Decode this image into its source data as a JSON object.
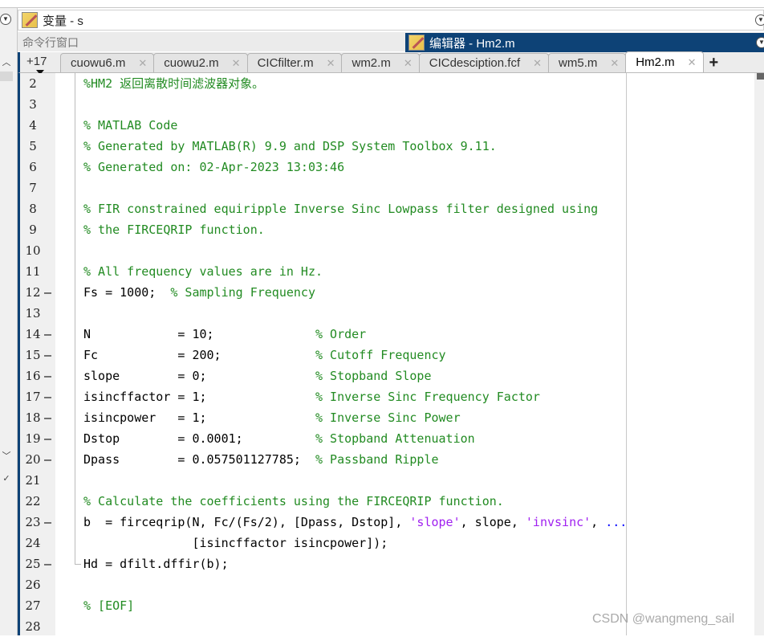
{
  "variables_panel": {
    "title": "变量 - s"
  },
  "command_window": {
    "title": "命令行窗口"
  },
  "editor": {
    "title": "编辑器 - Hm2.m"
  },
  "tabs": {
    "more_label": "+17",
    "items": [
      {
        "label": "cuowu6.m"
      },
      {
        "label": "cuowu2.m"
      },
      {
        "label": "CICfilter.m"
      },
      {
        "label": "wm2.m"
      },
      {
        "label": "CICdesciption.fcf"
      },
      {
        "label": "wm5.m"
      },
      {
        "label": "Hm2.m",
        "active": true
      }
    ],
    "close_glyph": "✕",
    "add_glyph": "+"
  },
  "code_lines": [
    {
      "n": "2",
      "dash": "",
      "segs": [
        [
          "c-com",
          "%HM2 返回离散时间滤波器对象。"
        ]
      ]
    },
    {
      "n": "3",
      "dash": "",
      "segs": []
    },
    {
      "n": "4",
      "dash": "",
      "segs": [
        [
          "c-com",
          "% MATLAB Code"
        ]
      ]
    },
    {
      "n": "5",
      "dash": "",
      "segs": [
        [
          "c-com",
          "% Generated by MATLAB(R) 9.9 and DSP System Toolbox 9.11."
        ]
      ]
    },
    {
      "n": "6",
      "dash": "",
      "segs": [
        [
          "c-com",
          "% Generated on: 02-Apr-2023 13:03:46"
        ]
      ]
    },
    {
      "n": "7",
      "dash": "",
      "segs": []
    },
    {
      "n": "8",
      "dash": "",
      "segs": [
        [
          "c-com",
          "% FIR constrained equiripple Inverse Sinc Lowpass filter designed using"
        ]
      ]
    },
    {
      "n": "9",
      "dash": "",
      "segs": [
        [
          "c-com",
          "% the FIRCEQRIP function."
        ]
      ]
    },
    {
      "n": "10",
      "dash": "",
      "segs": []
    },
    {
      "n": "11",
      "dash": "",
      "segs": [
        [
          "c-com",
          "% All frequency values are in Hz."
        ]
      ]
    },
    {
      "n": "12",
      "dash": "—",
      "segs": [
        [
          "c-txt",
          "Fs = 1000;  "
        ],
        [
          "c-com",
          "% Sampling Frequency"
        ]
      ]
    },
    {
      "n": "13",
      "dash": "",
      "segs": []
    },
    {
      "n": "14",
      "dash": "—",
      "segs": [
        [
          "c-txt",
          "N            = 10;              "
        ],
        [
          "c-com",
          "% Order"
        ]
      ]
    },
    {
      "n": "15",
      "dash": "—",
      "segs": [
        [
          "c-txt",
          "Fc           = 200;             "
        ],
        [
          "c-com",
          "% Cutoff Frequency"
        ]
      ]
    },
    {
      "n": "16",
      "dash": "—",
      "segs": [
        [
          "c-txt",
          "slope        = 0;               "
        ],
        [
          "c-com",
          "% Stopband Slope"
        ]
      ]
    },
    {
      "n": "17",
      "dash": "—",
      "segs": [
        [
          "c-txt",
          "isincffactor = 1;               "
        ],
        [
          "c-com",
          "% Inverse Sinc Frequency Factor"
        ]
      ]
    },
    {
      "n": "18",
      "dash": "—",
      "segs": [
        [
          "c-txt",
          "isincpower   = 1;               "
        ],
        [
          "c-com",
          "% Inverse Sinc Power"
        ]
      ]
    },
    {
      "n": "19",
      "dash": "—",
      "segs": [
        [
          "c-txt",
          "Dstop        = 0.0001;          "
        ],
        [
          "c-com",
          "% Stopband Attenuation"
        ]
      ]
    },
    {
      "n": "20",
      "dash": "—",
      "segs": [
        [
          "c-txt",
          "Dpass        = 0.057501127785;  "
        ],
        [
          "c-com",
          "% Passband Ripple"
        ]
      ]
    },
    {
      "n": "21",
      "dash": "",
      "segs": []
    },
    {
      "n": "22",
      "dash": "",
      "segs": [
        [
          "c-com",
          "% Calculate the coefficients using the FIRCEQRIP function."
        ]
      ]
    },
    {
      "n": "23",
      "dash": "—",
      "segs": [
        [
          "c-txt",
          "b  = firceqrip(N, Fc/(Fs/2), [Dpass, Dstop], "
        ],
        [
          "c-str",
          "'slope'"
        ],
        [
          "c-txt",
          ", slope, "
        ],
        [
          "c-str",
          "'invsinc'"
        ],
        [
          "c-txt",
          ", "
        ],
        [
          "c-kw",
          "..."
        ]
      ]
    },
    {
      "n": "24",
      "dash": "",
      "segs": [
        [
          "c-txt",
          "               [isincffactor isincpower]);"
        ]
      ]
    },
    {
      "n": "25",
      "dash": "—",
      "segs": [
        [
          "c-txt",
          "Hd = dfilt.dffir(b);"
        ]
      ]
    },
    {
      "n": "26",
      "dash": "",
      "segs": []
    },
    {
      "n": "27",
      "dash": "",
      "segs": [
        [
          "c-com",
          "% [EOF]"
        ]
      ]
    },
    {
      "n": "28",
      "dash": "",
      "segs": []
    }
  ],
  "watermark": "CSDN @wangmeng_sail"
}
